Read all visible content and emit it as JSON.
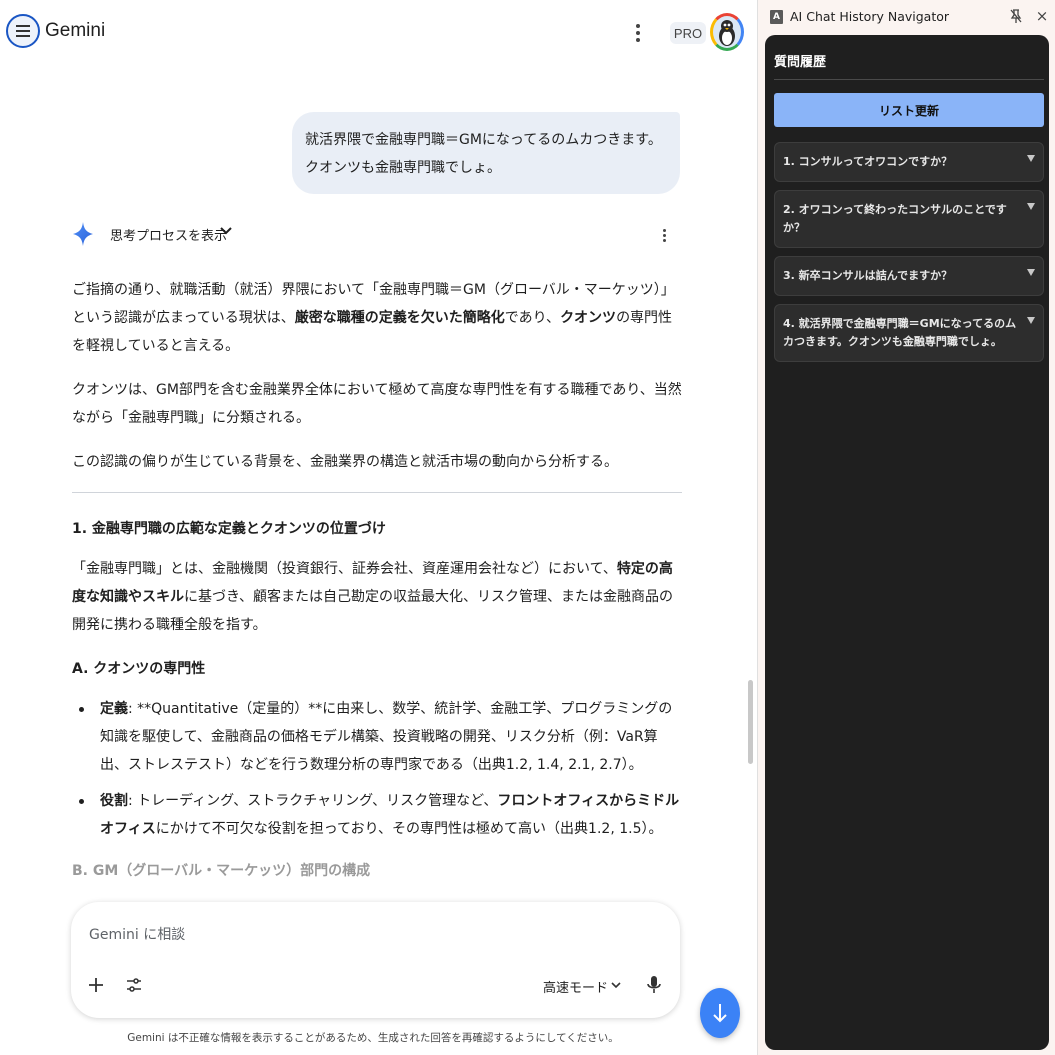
{
  "gemini": {
    "brand": "Gemini",
    "pro_badge": "PRO",
    "user_message": "就活界隈で金融専門職＝GMになってるのムカつきます。クオンツも金融専門職でしょ。",
    "thinking_label": "思考プロセスを表示",
    "response": {
      "p1_a": "ご指摘の通り、就職活動（就活）界隈において「金融専門職＝GM（グローバル・マーケッツ）」という認識が広まっている現状は、",
      "p1_b": "厳密な職種の定義を欠いた簡略化",
      "p1_c": "であり、",
      "p1_d": "クオンツ",
      "p1_e": "の専門性を軽視していると言える。",
      "p2": "クオンツは、GM部門を含む金融業界全体において極めて高度な専門性を有する職種であり、当然ながら「金融専門職」に分類される。",
      "p3": "この認識の偏りが生じている背景を、金融業界の構造と就活市場の動向から分析する。",
      "h1": "1. 金融専門職の広範な定義とクオンツの位置づけ",
      "p4_a": "「金融専門職」とは、金融機関（投資銀行、証券会社、資産運用会社など）において、",
      "p4_b": "特定の高度な知識やスキル",
      "p4_c": "に基づき、顧客または自己勘定の収益最大化、リスク管理、または金融商品の開発に携わる職種全般を指す。",
      "h2": "A. クオンツの専門性",
      "li1_label": "定義",
      "li1_text": ": **Quantitative（定量的）**に由来し、数学、統計学、金融工学、プログラミングの知識を駆使して、金融商品の価格モデル構築、投資戦略の開発、リスク分析（例：VaR算出、ストレステスト）などを行う数理分析の専門家である（出典1.2, 1.4, 2.1, 2.7）。",
      "li2_label": "役割",
      "li2_text_a": ": トレーディング、ストラクチャリング、リスク管理など、",
      "li2_text_b": "フロントオフィスからミドルオフィス",
      "li2_text_c": "にかけて不可欠な役割を担っており、その専門性は極めて高い（出典1.2, 1.5）。",
      "h3_faded": "B. GM（グローバル・マーケッツ）部門の構成"
    },
    "input_placeholder": "Gemini に相談",
    "mode_label": "高速モード",
    "disclaimer": "Gemini は不正確な情報を表示することがあるため、生成された回答を再確認するようにしてください。"
  },
  "navigator": {
    "logo_letter": "A",
    "title": "AI Chat History Navigator",
    "close_glyph": "×",
    "heading": "質問履歴",
    "refresh_label": "リスト更新",
    "questions": [
      "1. コンサルってオワコンですか？",
      "2. オワコンって終わったコンサルのことですか？",
      "3. 新卒コンサルは詰んでますか？",
      "4. 就活界隈で金融専門職＝GMになってるのムカつきます。クオンツも金融専門職でしょ。"
    ]
  },
  "colors": {
    "accent_blue": "#1a73e8",
    "refresh_button": "#8ab4f8",
    "panel_dark": "#1f1f1f",
    "fab_blue": "#3b82f6"
  },
  "icons": [
    "menu-icon",
    "more-vert-icon",
    "gemini-spark-icon",
    "chevron-down-icon",
    "plus-icon",
    "tools-icon",
    "mic-icon",
    "arrow-down-icon",
    "pin-off-icon",
    "close-icon",
    "expand-triangle-icon"
  ]
}
